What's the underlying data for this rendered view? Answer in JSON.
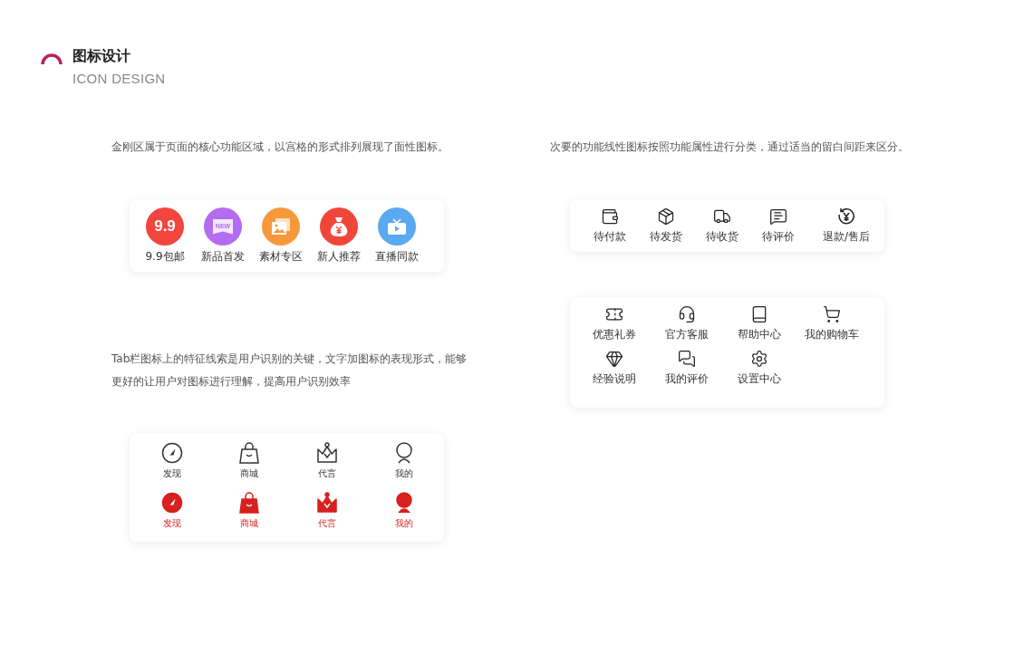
{
  "header": {
    "title": "图标设计",
    "subtitle": "ICON DESIGN"
  },
  "grid_section": {
    "description": "金刚区属于页面的核心功能区域，以宫格的形式排列展现了面性图标。",
    "items": [
      {
        "label": "9.9包邮",
        "kind": "text",
        "glyph": "9.9",
        "color": "#f2453d"
      },
      {
        "label": "新品首发",
        "kind": "banner",
        "glyph": "NEW",
        "color": "#b46cf0"
      },
      {
        "label": "素材专区",
        "kind": "picture",
        "color": "#f7993b"
      },
      {
        "label": "新人推荐",
        "kind": "moneybag",
        "color": "#f0463a"
      },
      {
        "label": "直播同款",
        "kind": "tv",
        "color": "#5ba9f0"
      }
    ]
  },
  "tab_section": {
    "description": "Tab栏图标上的特征线索是用户识别的关键，文字加图标的表现形式，能够更好的让用户对图标进行理解，提高用户识别效率",
    "rows": [
      {
        "items": [
          {
            "label": "发现",
            "kind": "compass",
            "selected": false
          },
          {
            "label": "商城",
            "kind": "bag",
            "selected": false
          },
          {
            "label": "代言",
            "kind": "crown",
            "selected": false
          },
          {
            "label": "我的",
            "kind": "person",
            "selected": false
          }
        ]
      },
      {
        "items": [
          {
            "label": "发现",
            "kind": "compass",
            "selected": true
          },
          {
            "label": "商城",
            "kind": "bag",
            "selected": true
          },
          {
            "label": "代言",
            "kind": "crown",
            "selected": true
          },
          {
            "label": "我的",
            "kind": "person",
            "selected": true
          }
        ]
      }
    ]
  },
  "order_section": {
    "description": "次要的功能线性图标按照功能属性进行分类，通过适当的留白间距来区分。",
    "items": [
      {
        "label": "待付款",
        "kind": "wallet"
      },
      {
        "label": "待发货",
        "kind": "package"
      },
      {
        "label": "待收货",
        "kind": "truck"
      },
      {
        "label": "待评价",
        "kind": "comment"
      },
      {
        "label": "退款/售后",
        "kind": "refund"
      }
    ]
  },
  "service_section": {
    "items": [
      {
        "label": "优惠礼券",
        "kind": "ticket"
      },
      {
        "label": "官方客服",
        "kind": "headset"
      },
      {
        "label": "帮助中心",
        "kind": "book"
      },
      {
        "label": "我的购物车",
        "kind": "cart"
      },
      {
        "label": "经验说明",
        "kind": "gem"
      },
      {
        "label": "我的评价",
        "kind": "comments"
      },
      {
        "label": "设置中心",
        "kind": "settings"
      }
    ]
  }
}
